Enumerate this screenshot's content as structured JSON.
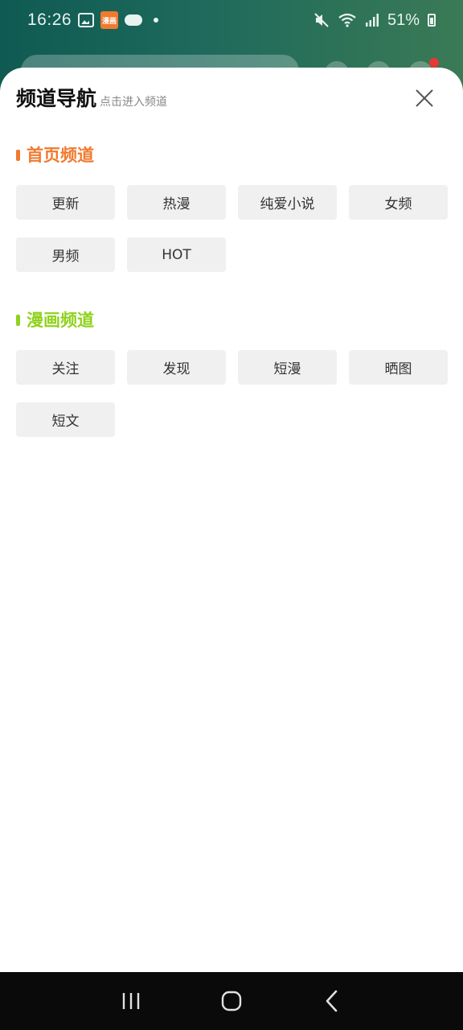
{
  "status_bar": {
    "time": "16:26",
    "battery": "51%",
    "notification_app_label": "漫画"
  },
  "sheet": {
    "title": "频道导航",
    "subtitle": "点击进入频道",
    "close_icon": "close-icon"
  },
  "sections": [
    {
      "title": "首页频道",
      "accent": "#f07a2e",
      "items": [
        "更新",
        "热漫",
        "纯爱小说",
        "女频",
        "男频",
        "HOT"
      ]
    },
    {
      "title": "漫画频道",
      "accent": "#8fd21d",
      "items": [
        "关注",
        "发现",
        "短漫",
        "晒图",
        "短文"
      ]
    }
  ],
  "nav_bar": {
    "recent_icon": "recent-apps-icon",
    "home_icon": "home-icon",
    "back_icon": "back-icon"
  }
}
